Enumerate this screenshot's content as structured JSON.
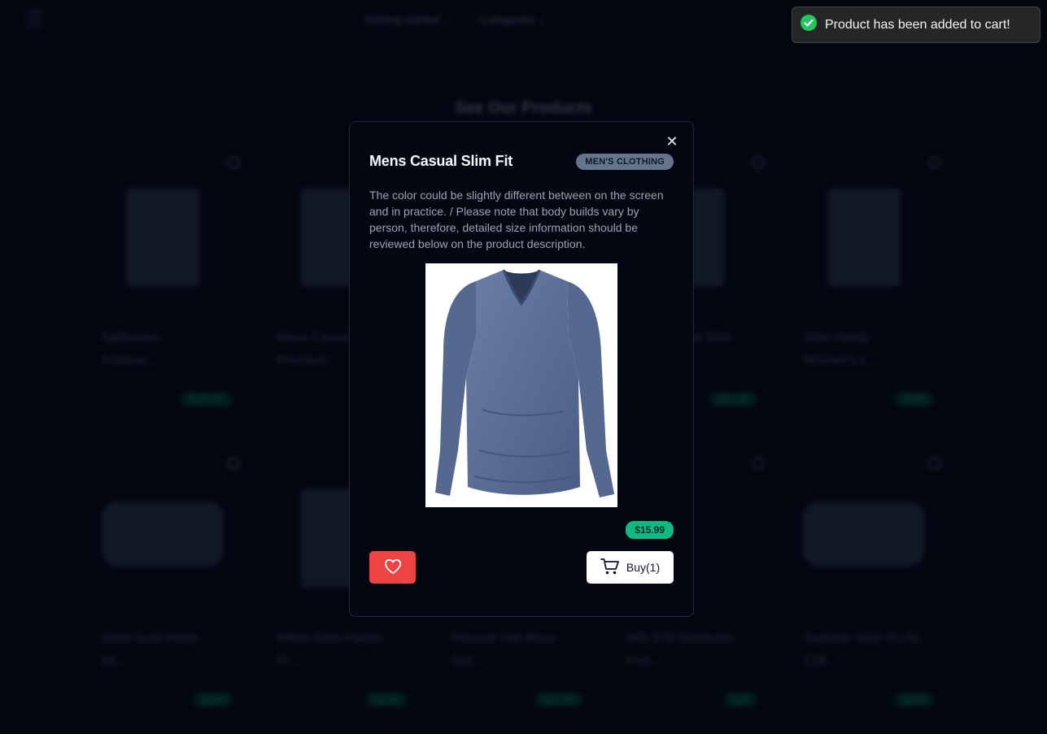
{
  "background": {
    "nav": {
      "links": [
        "Getting started",
        "Categories"
      ]
    },
    "section_title": "See Our Products",
    "cards_row1": [
      {
        "name": "Fjallraven - Foldsac...",
        "price": "$109.95"
      },
      {
        "name": "Mens Casual Premium",
        "price": ""
      },
      {
        "name": "",
        "price": ""
      },
      {
        "name": "Mens Casual Slim",
        "price": "$15.99"
      },
      {
        "name": "John Hardy Women's L...",
        "price": "$695"
      }
    ],
    "cards_row2": [
      {
        "name": "Solid Gold Petite Mi...",
        "price": "$168"
      },
      {
        "name": "White Gold Plated Pr...",
        "price": "$9.99"
      },
      {
        "name": "Pierced Owl Rose Gol...",
        "price": "$10.99"
      },
      {
        "name": "WD 2TB Elements Port...",
        "price": "$64"
      },
      {
        "name": "SanDisk SSD PLUS 1TB...",
        "price": "$109"
      }
    ]
  },
  "modal": {
    "title": "Mens Casual Slim Fit",
    "category": "MEN'S CLOTHING",
    "description": "The color could be slightly different between on the screen and in practice. / Please note that body builds vary by person, therefore, detailed size information should be reviewed below on the product description.",
    "price": "$15.99",
    "buy_label": "Buy(1)",
    "close_icon": "close-icon",
    "wishlist_icon": "heart-icon",
    "cart_icon": "cart-icon"
  },
  "toast": {
    "message": "Product has been added to cart!",
    "icon": "check-circle-icon",
    "accent": "#22c55e"
  },
  "colors": {
    "background": "#030712",
    "price_badge": "#10b981",
    "wishlist_button": "#ef4444",
    "category_badge": "#64748b"
  }
}
